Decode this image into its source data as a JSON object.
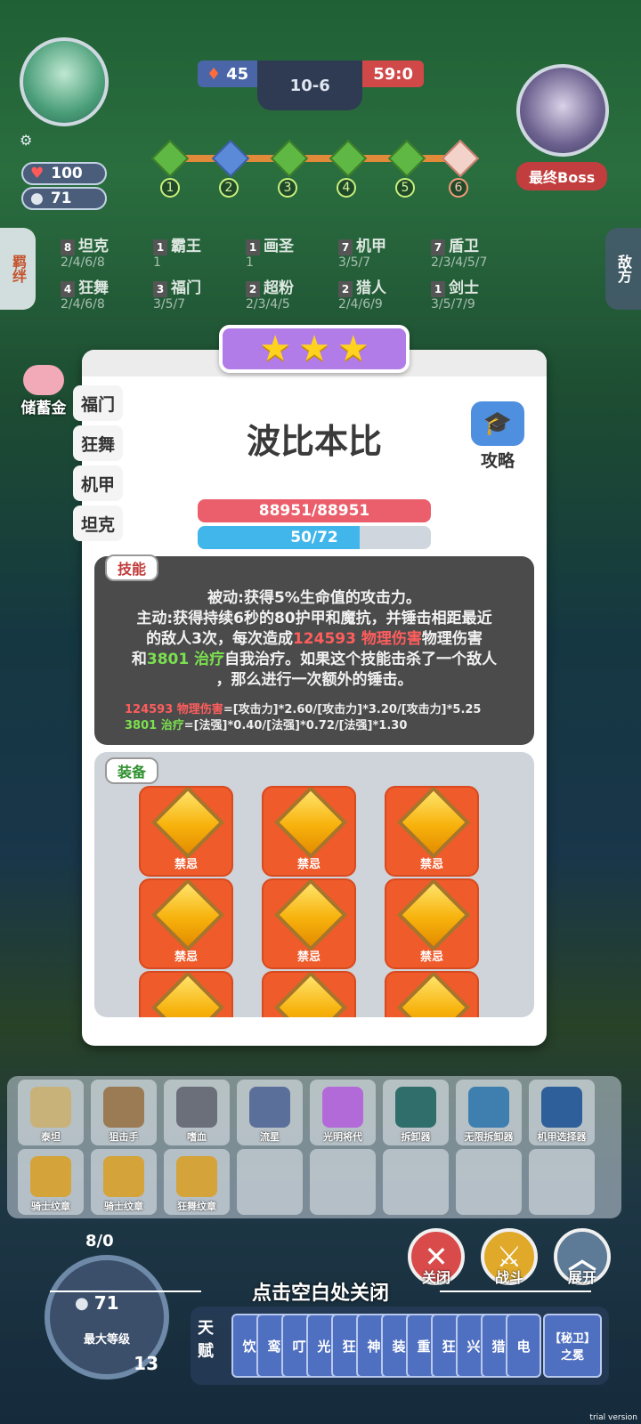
{
  "hud": {
    "lives": "45",
    "wave": "10-6",
    "score": "59:0",
    "hp_stat": "100",
    "coin_stat": "71",
    "stages": [
      "1",
      "2",
      "3",
      "4",
      "5",
      "6"
    ],
    "boss_label": "最终Boss"
  },
  "side": {
    "left_tab": "羁绊",
    "right_tab": "敌方",
    "piggy_label": "储蓄金"
  },
  "traits": [
    {
      "count": "8",
      "name": "坦克",
      "levels": "2/4/6/8"
    },
    {
      "count": "1",
      "name": "霸王",
      "levels": "1"
    },
    {
      "count": "1",
      "name": "画圣",
      "levels": "1"
    },
    {
      "count": "7",
      "name": "机甲",
      "levels": "3/5/7"
    },
    {
      "count": "7",
      "name": "盾卫",
      "levels": "2/3/4/5/7"
    },
    {
      "count": "4",
      "name": "狂舞",
      "levels": "2/4/6/8"
    },
    {
      "count": "3",
      "name": "福门",
      "levels": "3/5/7"
    },
    {
      "count": "2",
      "name": "超粉",
      "levels": "2/3/4/5"
    },
    {
      "count": "2",
      "name": "猎人",
      "levels": "2/4/6/9"
    },
    {
      "count": "1",
      "name": "剑士",
      "levels": "3/5/7/9"
    }
  ],
  "modal": {
    "hero_name": "波比本比",
    "strategy_label": "攻略",
    "tabs": [
      "福门",
      "狂舞",
      "机甲",
      "坦克"
    ],
    "hp": "88951/88951",
    "hp_fraction": 1.0,
    "mana": "50/72",
    "mana_fraction": 0.694,
    "skill_tag": "技能",
    "skill_line1": "被动:获得5%生命值的攻击力。",
    "skill_line2": "主动:获得持续6秒的80护甲和魔抗，并锤击相距最近",
    "skill_line3a": "的敌人3次，每次造成",
    "skill_line3b": "124593 物理伤害",
    "skill_line3c": "物理伤害",
    "skill_line4a": "和",
    "skill_line4b": "3801 治疗",
    "skill_line4c": "自我治疗。如果这个技能击杀了一个敌人",
    "skill_line5": "，那么进行一次额外的锤击。",
    "formula1_value": "124593 物理伤害",
    "formula1_rest": "=[攻击力]*2.60/[攻击力]*3.20/[攻击力]*5.25",
    "formula2_value": "3801 治疗",
    "formula2_rest": "=[法强]*0.40/[法强]*0.72/[法强]*1.30",
    "equip_tag": "装备",
    "equipment": [
      "禁忌",
      "禁忌",
      "禁忌",
      "禁忌",
      "禁忌",
      "禁忌",
      "禁忌",
      "禁忌",
      "禁忌"
    ]
  },
  "inventory": [
    "泰坦",
    "狙击手",
    "嗜血",
    "流星",
    "光明将代",
    "拆卸器",
    "无限拆卸器",
    "机甲选择器",
    "骑士纹章",
    "骑士纹章",
    "狂舞纹章"
  ],
  "close_hint": "点击空白处关闭",
  "buttons": {
    "close": "关闭",
    "battle": "战斗",
    "expand": "展开"
  },
  "level": {
    "exp": "8/0",
    "coins": "71",
    "max_label": "最大等级",
    "level_num": "13"
  },
  "talent": {
    "label": "天赋",
    "cards": [
      "饮",
      "鸾",
      "叮",
      "光",
      "狂",
      "神",
      "装",
      "重",
      "狂",
      "兴",
      "猎",
      "电"
    ],
    "last_card": "【秘卫】之冕"
  },
  "watermark": "trial version",
  "colors": {
    "star_ribbon": "#b17be8",
    "hp_bar": "#ea5f6b",
    "mana_bar": "#41b6ea",
    "equip_card": "#ef5b2a"
  }
}
